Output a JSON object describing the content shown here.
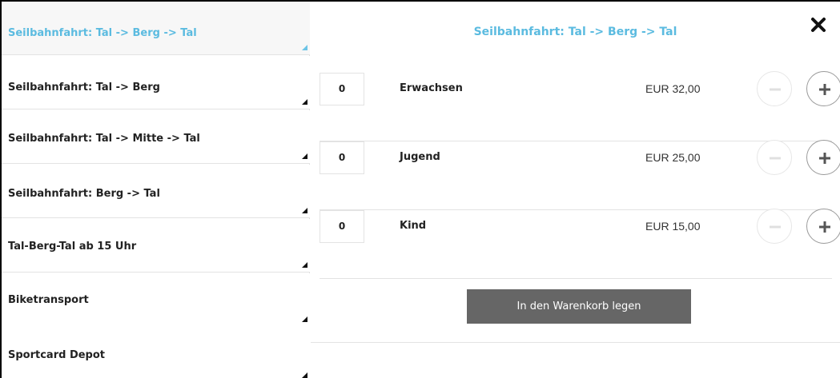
{
  "sidebar": {
    "items": [
      {
        "label": "Seilbahnfahrt: Tal -> Berg -> Tal",
        "active": true
      },
      {
        "label": "Seilbahnfahrt: Tal -> Berg",
        "active": false
      },
      {
        "label": "Seilbahnfahrt: Tal -> Mitte -> Tal",
        "active": false
      },
      {
        "label": "Seilbahnfahrt: Berg -> Tal",
        "active": false
      },
      {
        "label": "Tal-Berg-Tal ab 15 Uhr",
        "active": false
      },
      {
        "label": "Biketransport",
        "active": false
      },
      {
        "label": "Sportcard Depot",
        "active": false
      }
    ]
  },
  "panel": {
    "title": "Seilbahnfahrt: Tal -> Berg -> Tal",
    "close_icon": "close-icon",
    "rows": [
      {
        "qty": "0",
        "name": "Erwachsen",
        "price": "EUR 32,00"
      },
      {
        "qty": "0",
        "name": "Jugend",
        "price": "EUR 25,00"
      },
      {
        "qty": "0",
        "name": "Kind",
        "price": "EUR 15,00"
      }
    ],
    "cart_button": "In den Warenkorb legen"
  },
  "colors": {
    "accent": "#5bbbe0",
    "button_bg": "#666666",
    "border": "#e3e3e3"
  }
}
